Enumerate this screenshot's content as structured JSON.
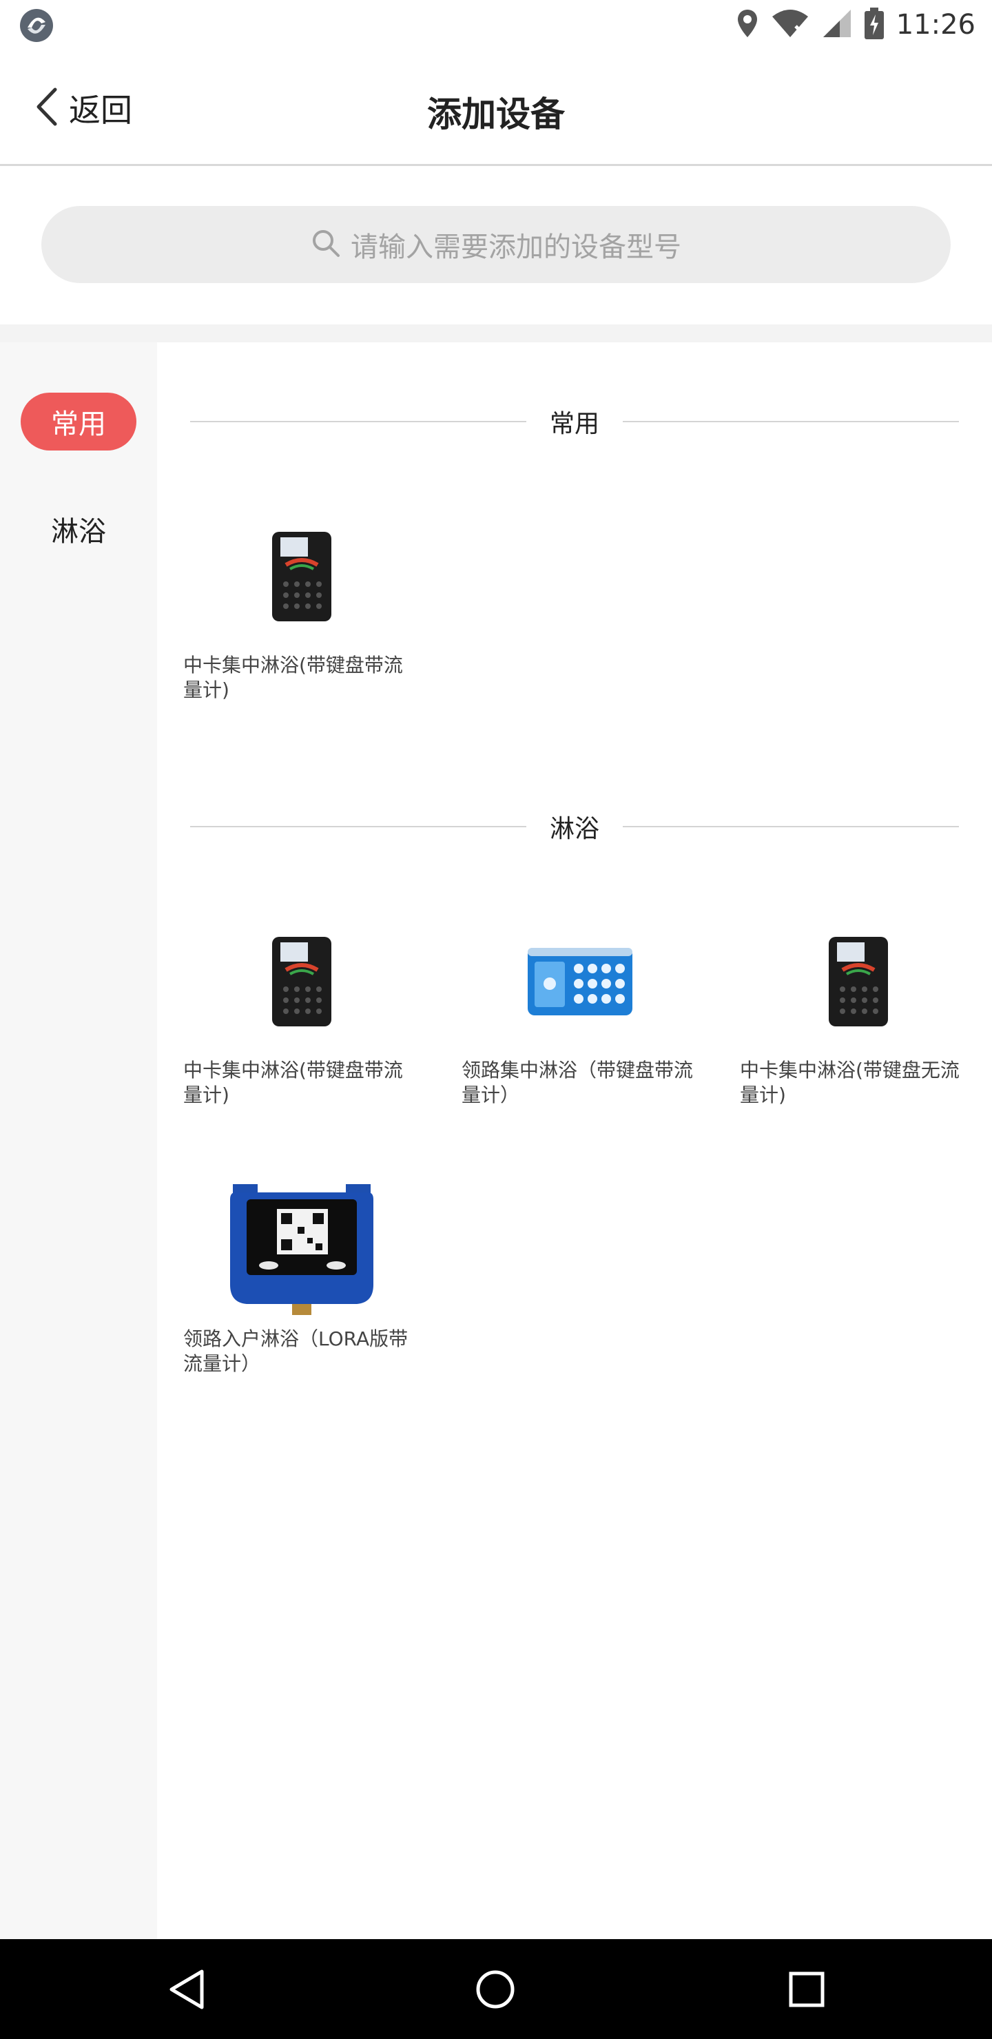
{
  "status_bar": {
    "time": "11:26",
    "icons": [
      "app-logo-icon",
      "location-icon",
      "wifi-off-icon",
      "signal-icon",
      "battery-charging-icon"
    ]
  },
  "header": {
    "back_label": "返回",
    "title": "添加设备"
  },
  "search": {
    "placeholder": "请输入需要添加的设备型号"
  },
  "sidebar": {
    "items": [
      {
        "label": "常用",
        "active": true
      },
      {
        "label": "淋浴",
        "active": false
      }
    ]
  },
  "sections": [
    {
      "title": "常用",
      "devices": [
        {
          "name": "中卡集中淋浴(带键盘带流量计)",
          "image": "black-card-terminal"
        }
      ]
    },
    {
      "title": "淋浴",
      "devices": [
        {
          "name": "中卡集中淋浴(带键盘带流量计)",
          "image": "black-card-terminal"
        },
        {
          "name": "领路集中淋浴（带键盘带流量计）",
          "image": "blue-keypad-terminal"
        },
        {
          "name": "中卡集中淋浴(带键盘无流量计)",
          "image": "black-card-terminal"
        },
        {
          "name": "领路入户淋浴（LORA版带流量计）",
          "image": "blue-qr-meter"
        }
      ]
    }
  ],
  "bottom_nav": {
    "buttons": [
      "back-triangle-icon",
      "home-circle-icon",
      "recents-square-icon"
    ]
  },
  "colors": {
    "accent": "#ee5a5a",
    "sidebar_bg": "#f7f7f7",
    "search_bg": "#ececec"
  }
}
